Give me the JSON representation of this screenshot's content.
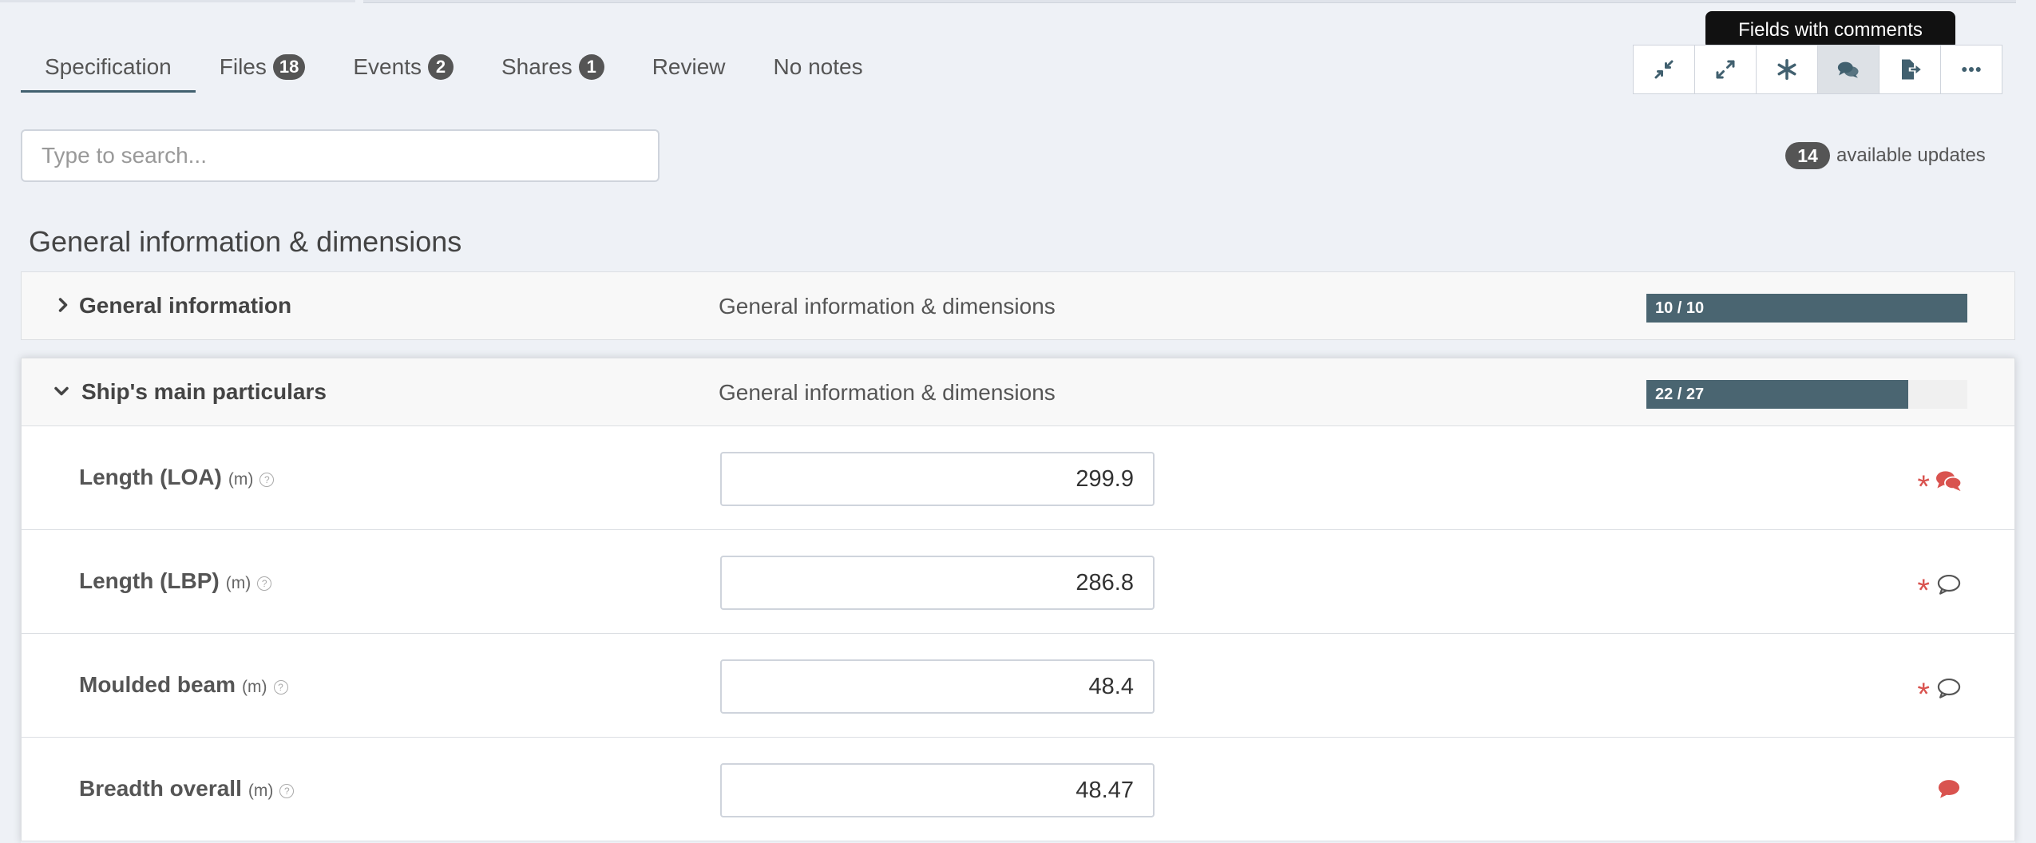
{
  "tabs": [
    {
      "label": "Specification",
      "badge": null
    },
    {
      "label": "Files",
      "badge": "18"
    },
    {
      "label": "Events",
      "badge": "2"
    },
    {
      "label": "Shares",
      "badge": "1"
    },
    {
      "label": "Review",
      "badge": null
    },
    {
      "label": "No notes",
      "badge": null
    }
  ],
  "toolbar": {
    "tooltip": "Fields with comments",
    "buttons": [
      "collapse-icon",
      "expand-icon",
      "asterisk-icon",
      "comments-icon",
      "export-icon",
      "more-icon"
    ]
  },
  "search": {
    "placeholder": "Type to search..."
  },
  "updates": {
    "count": "14",
    "label": "available updates"
  },
  "section": {
    "title": "General information & dimensions"
  },
  "groups": [
    {
      "name": "General information",
      "description": "General information & dimensions",
      "progress_text": "10 / 10",
      "progress": 1.0,
      "expanded": false
    },
    {
      "name": "Ship's main particulars",
      "description": "General information & dimensions",
      "progress_text": "22 / 27",
      "progress": 0.8148,
      "expanded": true
    }
  ],
  "fields": [
    {
      "label": "Length (LOA)",
      "unit": "(m)",
      "value": "299.9",
      "required": true,
      "comment": "filled-multi"
    },
    {
      "label": "Length (LBP)",
      "unit": "(m)",
      "value": "286.8",
      "required": true,
      "comment": "outline"
    },
    {
      "label": "Moulded beam",
      "unit": "(m)",
      "value": "48.4",
      "required": true,
      "comment": "outline"
    },
    {
      "label": "Breadth overall",
      "unit": "(m)",
      "value": "48.47",
      "required": false,
      "comment": "filled"
    }
  ],
  "colors": {
    "accent": "#41606f",
    "progress": "#4a6571",
    "required": "#d9534f",
    "badge": "#555555"
  }
}
